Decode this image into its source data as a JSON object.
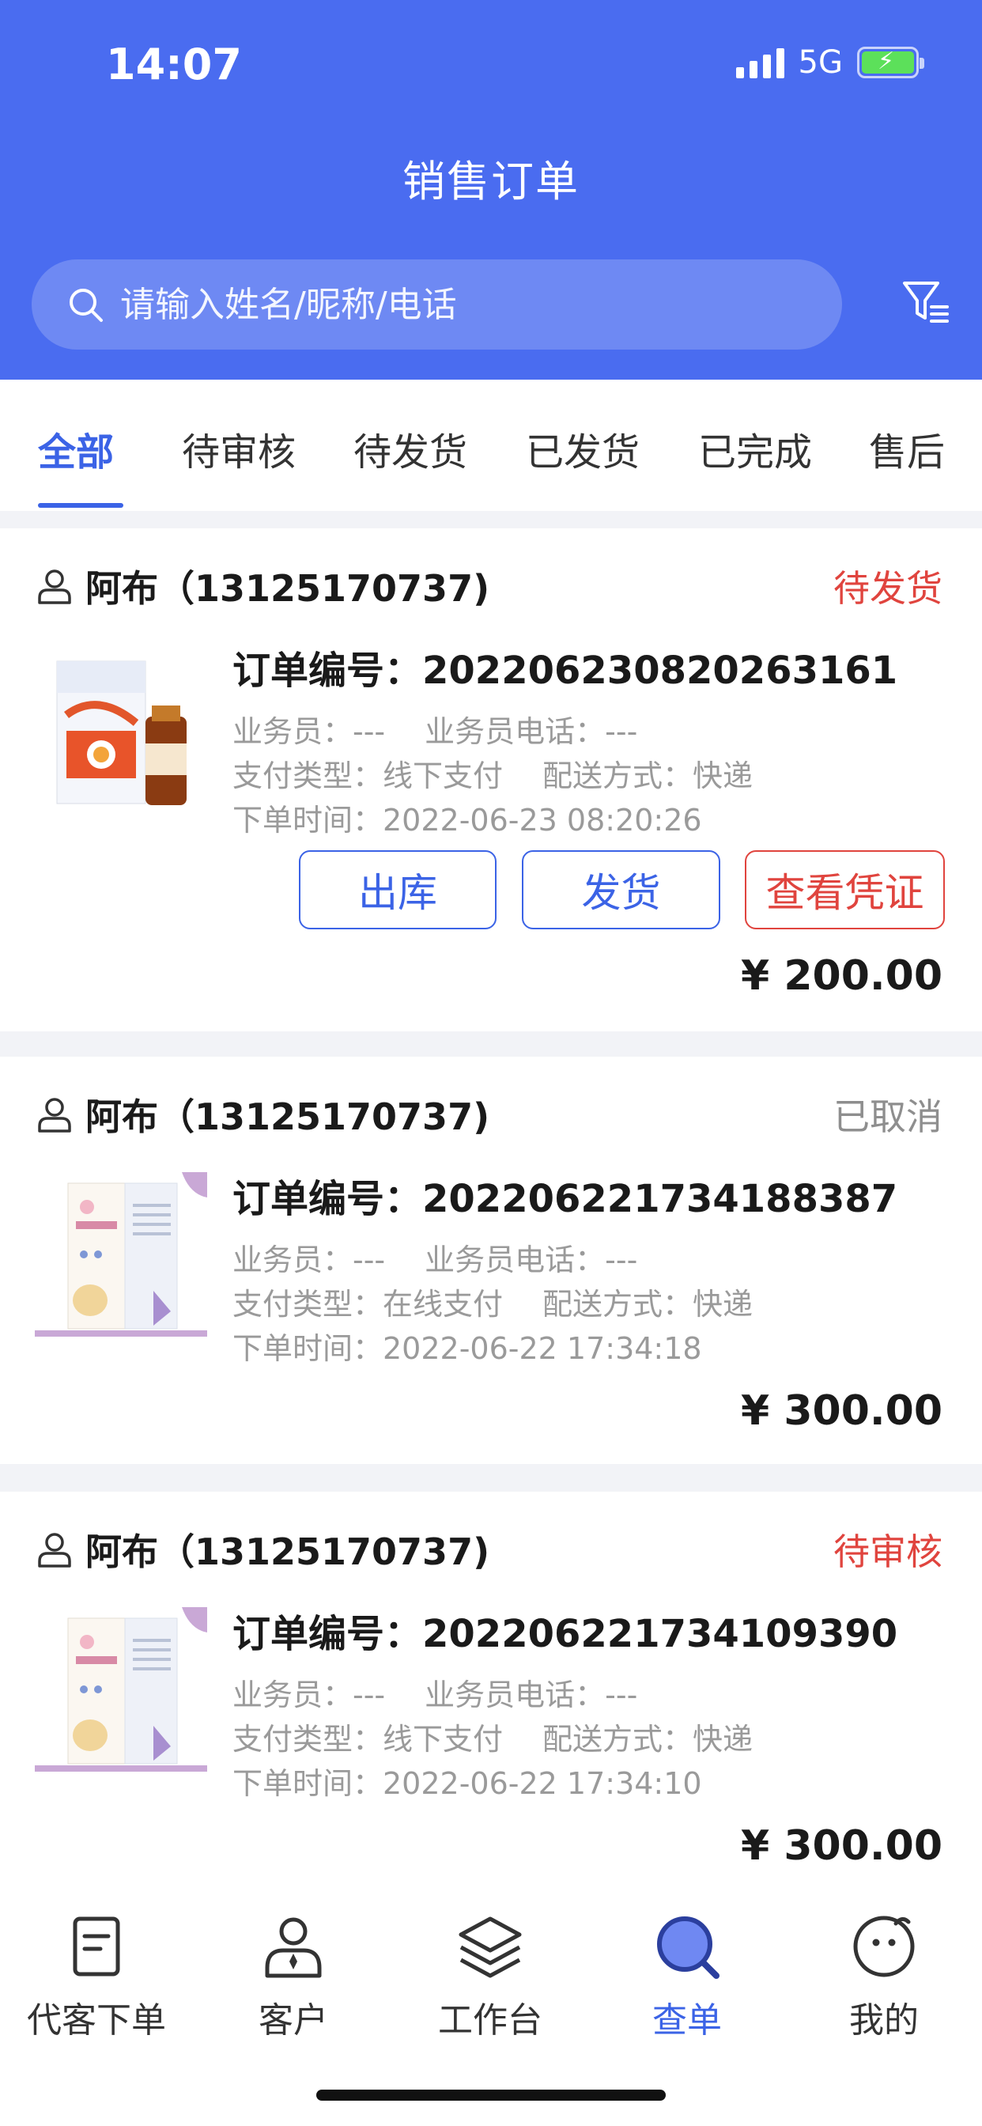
{
  "status_bar": {
    "time": "14:07",
    "network": "5G"
  },
  "header": {
    "title": "销售订单"
  },
  "search": {
    "placeholder": "请输入姓名/昵称/电话"
  },
  "tabs": [
    {
      "label": "全部",
      "active": true
    },
    {
      "label": "待审核",
      "active": false
    },
    {
      "label": "待发货",
      "active": false
    },
    {
      "label": "已发货",
      "active": false
    },
    {
      "label": "已完成",
      "active": false
    },
    {
      "label": "售后",
      "active": false
    }
  ],
  "orders": [
    {
      "customer": "阿布（13125170737)",
      "status": "待发货",
      "status_color": "#e0443e",
      "order_no": "订单编号：2022062308202631 61",
      "salesman": "业务员：---",
      "salesman_phone": "业务员电话：---",
      "pay_type": "支付类型：线下支付",
      "delivery": "配送方式：快递",
      "order_time": "下单时间：2022-06-23 08:20:26",
      "buttons": [
        "出库",
        "发货",
        "查看凭证"
      ],
      "price": "¥ 200.00"
    },
    {
      "customer": "阿布（13125170737)",
      "status": "已取消",
      "status_color": "#8e8e8e",
      "order_no": "订单编号：202206221734188387",
      "salesman": "业务员：---",
      "salesman_phone": "业务员电话：---",
      "pay_type": "支付类型：在线支付",
      "delivery": "配送方式：快递",
      "order_time": "下单时间：2022-06-22 17:34:18",
      "price": "¥ 300.00"
    },
    {
      "customer": "阿布（13125170737)",
      "status": "待审核",
      "status_color": "#e0443e",
      "order_no": "订单编号：202206221734109390",
      "salesman": "业务员：---",
      "salesman_phone": "业务员电话：---",
      "pay_type": "支付类型：线下支付",
      "delivery": "配送方式：快递",
      "order_time": "下单时间：2022-06-22 17:34:10",
      "price": "¥ 300.00"
    }
  ],
  "bottom_nav": [
    {
      "label": "代客下单",
      "icon": "order-form-icon",
      "active": false
    },
    {
      "label": "客户",
      "icon": "customer-icon",
      "active": false
    },
    {
      "label": "工作台",
      "icon": "layers-icon",
      "active": false
    },
    {
      "label": "查单",
      "icon": "search-order-icon",
      "active": true
    },
    {
      "label": "我的",
      "icon": "profile-face-icon",
      "active": false
    }
  ],
  "colors": {
    "primary": "#4a6cf0",
    "accent_blue": "#3b63e6",
    "alert_red": "#e0443e",
    "muted_gray": "#8e8e8e"
  }
}
